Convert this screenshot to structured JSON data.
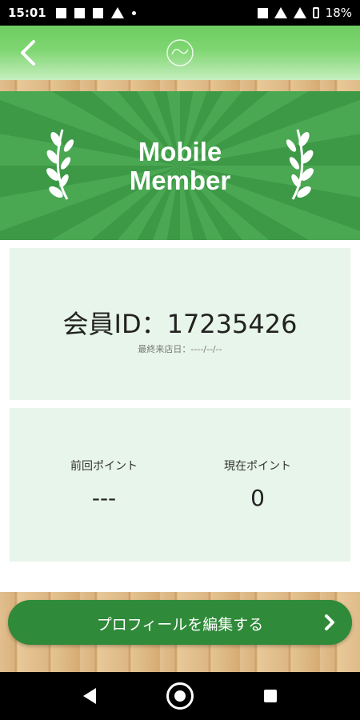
{
  "status_bar": {
    "time": "15:01",
    "battery": "18%"
  },
  "banner": {
    "title_line1": "Mobile",
    "title_line2": "Member"
  },
  "member": {
    "id_label": "会員ID：17235426",
    "last_visit": "最終来店日：----/--/--"
  },
  "points": {
    "previous_label": "前回ポイント",
    "previous_value": "---",
    "current_label": "現在ポイント",
    "current_value": "0"
  },
  "actions": {
    "edit_profile": "プロフィールを編集する"
  },
  "colors": {
    "header_green": "#7fd672",
    "banner_green": "#4aa852",
    "button_green": "#2f8a3a",
    "card_bg": "#e8f5ea"
  }
}
